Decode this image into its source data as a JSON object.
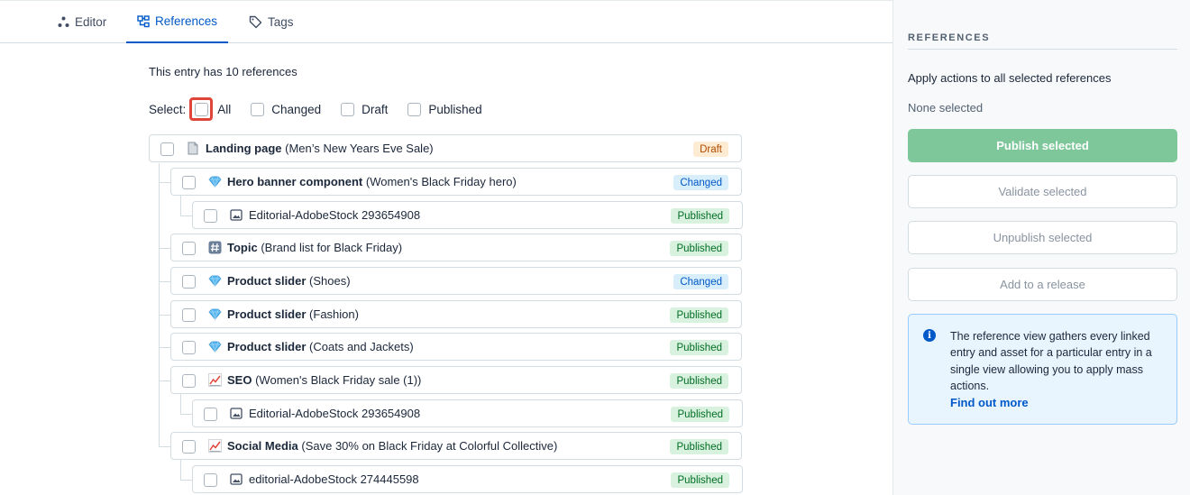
{
  "tabs": [
    {
      "label": "Editor",
      "icon": "editor-tree-icon"
    },
    {
      "label": "References",
      "icon": "references-icon",
      "active": true
    },
    {
      "label": "Tags",
      "icon": "tag-icon"
    }
  ],
  "summary": "This entry has 10 references",
  "select": {
    "label": "Select:",
    "options": [
      "All",
      "Changed",
      "Draft",
      "Published"
    ]
  },
  "references": [
    {
      "title": "Landing page",
      "subtitle": "(Men’s New Years Eve Sale)",
      "icon": "page-icon",
      "status": "Draft"
    },
    {
      "title": "Hero banner component",
      "subtitle": "(Women's Black Friday hero)",
      "icon": "gem-icon",
      "status": "Changed"
    },
    {
      "title": "",
      "subtitle": "Editorial-AdobeStock 293654908",
      "icon": "image-icon",
      "status": "Published"
    },
    {
      "title": "Topic",
      "subtitle": "(Brand list for Black Friday)",
      "icon": "hash-icon",
      "status": "Published"
    },
    {
      "title": "Product slider",
      "subtitle": "(Shoes)",
      "icon": "gem-icon",
      "status": "Changed"
    },
    {
      "title": "Product slider",
      "subtitle": "(Fashion)",
      "icon": "gem-icon",
      "status": "Published"
    },
    {
      "title": "Product slider",
      "subtitle": "(Coats and Jackets)",
      "icon": "gem-icon",
      "status": "Published"
    },
    {
      "title": "SEO",
      "subtitle": "(Women's Black Friday sale (1))",
      "icon": "chart-icon",
      "status": "Published"
    },
    {
      "title": "",
      "subtitle": "Editorial-AdobeStock 293654908",
      "icon": "image-icon",
      "status": "Published"
    },
    {
      "title": "Social Media",
      "subtitle": "(Save 30% on Black Friday at Colorful Collective)",
      "icon": "chart-icon",
      "status": "Published"
    },
    {
      "title": "",
      "subtitle": "editorial-AdobeStock 274445598",
      "icon": "image-icon",
      "status": "Published"
    }
  ],
  "sidebar": {
    "heading": "REFERENCES",
    "apply_text": "Apply actions to all selected references",
    "selection_status": "None selected",
    "buttons": {
      "publish": "Publish selected",
      "validate": "Validate selected",
      "unpublish": "Unpublish selected",
      "release": "Add to a release"
    },
    "note": {
      "text": "The reference view gathers every linked entry and asset for a particular entry in a single view allowing you to apply mass actions.",
      "link": "Find out more"
    }
  },
  "colors": {
    "accent": "#0059c8",
    "publish_button": "#7dc79a",
    "highlight": "#e0453a"
  }
}
